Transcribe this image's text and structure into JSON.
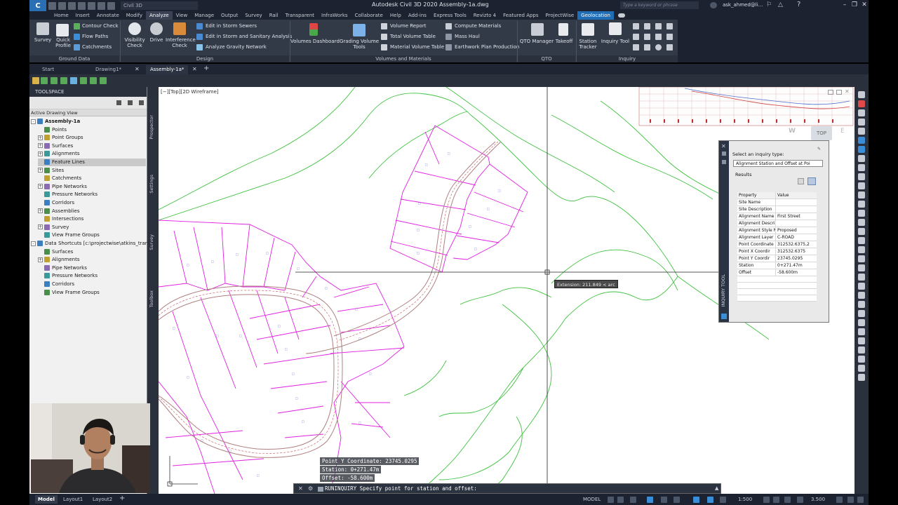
{
  "titlebar": {
    "logo": "C",
    "workspace": "Civil 3D",
    "title": "Autodesk Civil 3D 2020    Assembly-1a.dwg",
    "search_placeholder": "Type a keyword or phrase",
    "user": "ask_ahmed@li...",
    "help": "?"
  },
  "ribbon_tabs": [
    "Home",
    "Insert",
    "Annotate",
    "Modify",
    "Analyze",
    "View",
    "Manage",
    "Output",
    "Survey",
    "Rail",
    "Transparent",
    "InfraWorks",
    "Collaborate",
    "Help",
    "Add-ins",
    "Express Tools",
    "Revizto 4",
    "Featured Apps",
    "ProjectWise",
    "Geolocation"
  ],
  "active_tab": "Analyze",
  "ribbon": {
    "ground_data": {
      "title": "Ground Data",
      "survey": "Survey",
      "quick_profile": "Quick\nProfile",
      "contour_check": "Contour Check",
      "flow_paths": "Flow Paths",
      "catchments": "Catchments"
    },
    "design": {
      "title": "Design",
      "visibility_check": "Visibility\nCheck",
      "drive": "Drive",
      "interference_check": "Interference\nCheck",
      "edit_storm_sewers": "Edit in Storm Sewers",
      "edit_storm_sanitary": "Edit in Storm and Sanitary Analysis",
      "analyze_gravity": "Analyze Gravity Network"
    },
    "volumes": {
      "title": "Volumes and Materials",
      "volumes_dashboard": "Volumes Dashboard",
      "grading_volume_tools": "Grading Volume\nTools",
      "volume_report": "Volume Report",
      "total_volume_table": "Total Volume Table",
      "material_volume_table": "Material Volume Table",
      "compute_materials": "Compute Materials",
      "mass_haul": "Mass Haul",
      "earthwork_plan": "Earthwork Plan Production"
    },
    "qto": {
      "title": "QTO",
      "qto_manager": "QTO Manager",
      "takeoff": "Takeoff"
    },
    "inquiry": {
      "title": "Inquiry",
      "station_tracker": "Station\nTracker",
      "inquiry_tool": "Inquiry Tool"
    }
  },
  "file_tabs": [
    "Start",
    "Drawing1*",
    "Assembly-1a*"
  ],
  "active_file_tab": "Assembly-1a*",
  "toolspace": {
    "header": "TOOLSPACE",
    "view_select": "Active Drawing View",
    "tree": [
      {
        "label": "Assembly-1a",
        "level": 0,
        "expander": "-",
        "bold": true
      },
      {
        "label": "Points",
        "level": 1,
        "expander": ""
      },
      {
        "label": "Point Groups",
        "level": 1,
        "expander": "+"
      },
      {
        "label": "Surfaces",
        "level": 1,
        "expander": "+"
      },
      {
        "label": "Alignments",
        "level": 1,
        "expander": "+"
      },
      {
        "label": "Feature Lines",
        "level": 1,
        "expander": "",
        "selected": true
      },
      {
        "label": "Sites",
        "level": 1,
        "expander": "+"
      },
      {
        "label": "Catchments",
        "level": 1,
        "expander": ""
      },
      {
        "label": "Pipe Networks",
        "level": 1,
        "expander": "+"
      },
      {
        "label": "Pressure Networks",
        "level": 1,
        "expander": ""
      },
      {
        "label": "Corridors",
        "level": 1,
        "expander": ""
      },
      {
        "label": "Assemblies",
        "level": 1,
        "expander": "+"
      },
      {
        "label": "Intersections",
        "level": 1,
        "expander": ""
      },
      {
        "label": "Survey",
        "level": 1,
        "expander": "+"
      },
      {
        "label": "View Frame Groups",
        "level": 1,
        "expander": ""
      },
      {
        "label": "Data Shortcuts [c:\\projectwise\\atkins_transp...",
        "level": 0,
        "expander": "-"
      },
      {
        "label": "Surfaces",
        "level": 1,
        "expander": ""
      },
      {
        "label": "Alignments",
        "level": 1,
        "expander": "+"
      },
      {
        "label": "Pipe Networks",
        "level": 1,
        "expander": ""
      },
      {
        "label": "Pressure Networks",
        "level": 1,
        "expander": ""
      },
      {
        "label": "Corridors",
        "level": 1,
        "expander": ""
      },
      {
        "label": "View Frame Groups",
        "level": 1,
        "expander": ""
      }
    ],
    "side_tabs": [
      "Prospector",
      "Settings",
      "Survey",
      "Toolbox"
    ]
  },
  "viewport": {
    "label": "[−][Top][2D Wireframe]",
    "tooltip": "Extension: 211.849 < arc",
    "viewcube_top": "TOP",
    "viewcube_w": "W"
  },
  "inquiry_tool": {
    "side_title": "INQUIRY TOOL",
    "type_label": "Select an inquiry type:",
    "type_value": "Alignment Station and Offset at Poi",
    "results_label": "Results",
    "columns": [
      "Property",
      "Value"
    ],
    "rows": [
      {
        "p": "Site Name",
        "v": ""
      },
      {
        "p": "Site Description",
        "v": ""
      },
      {
        "p": "Alignment Name",
        "v": "First Street"
      },
      {
        "p": "Alignment Descri",
        "v": ""
      },
      {
        "p": "Alignment Style N",
        "v": "Proposed"
      },
      {
        "p": "Alignment Layer",
        "v": "C-ROAD"
      },
      {
        "p": "Point Coordinate",
        "v": "312532.6375,2"
      },
      {
        "p": "  Point X Coordir",
        "v": "312532.6375"
      },
      {
        "p": "  Point Y Coordir",
        "v": "23745.0295"
      },
      {
        "p": "Station",
        "v": "0+271.47m"
      },
      {
        "p": "Offset",
        "v": "-58.600m"
      }
    ]
  },
  "command": {
    "history": [
      "Point Y Coordinate:  23745.0295",
      "Station:  0+271.47m",
      "Offset:  -58.600m"
    ],
    "current": "RUNINQUIRY Specify point for station and offset:"
  },
  "status": {
    "layout_tabs": [
      "Model",
      "Layout1",
      "Layout2"
    ],
    "active_layout": "Model",
    "model_label": "MODEL",
    "scale": "1:500",
    "value": "3.500"
  },
  "colors": {
    "lots": "#e020e0",
    "contours": "#3fc23f",
    "alignment": "#c08080",
    "selection": "#1f6db4"
  }
}
